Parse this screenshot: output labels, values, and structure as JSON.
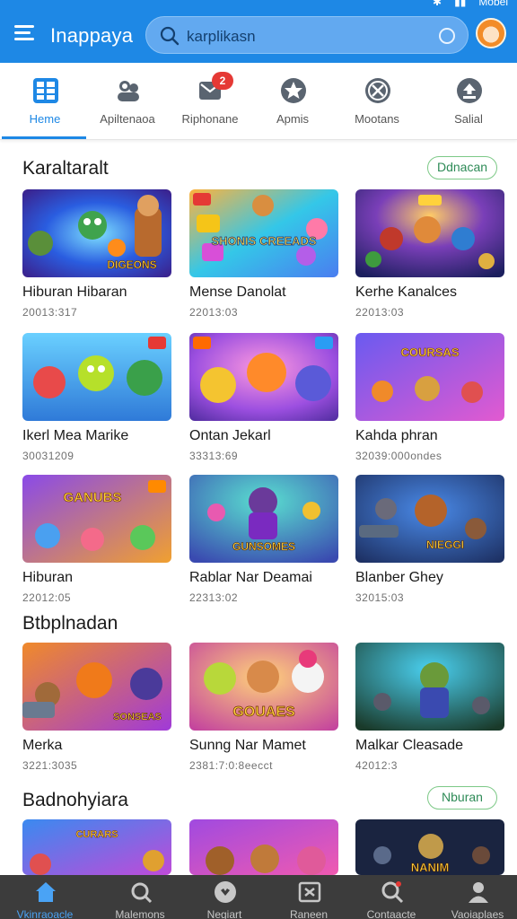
{
  "header": {
    "title": "Inappaya",
    "search_value": "karplikasn",
    "status_text": "Mobel",
    "colors": {
      "bar": "#1e88e5",
      "bottom_nav": "#3c3c3c",
      "accent": "#1e88e5",
      "more_border": "#7dc987"
    }
  },
  "tabs": [
    {
      "label": "Heme",
      "icon": "grid-icon",
      "active": true
    },
    {
      "label": "Apiltenaoa",
      "icon": "people-icon"
    },
    {
      "label": "Riphonane",
      "icon": "mail-icon",
      "badge": "2"
    },
    {
      "label": "Apmis",
      "icon": "star-icon"
    },
    {
      "label": "Mootans",
      "icon": "compass-icon"
    },
    {
      "label": "Salial",
      "icon": "download-icon"
    }
  ],
  "sections": [
    {
      "title": "Karaltaralt",
      "more": "Ddnacan",
      "cards": [
        {
          "title": "Hiburan Hibaran",
          "sub": "20013:317",
          "thumb_text": "DIGEONS"
        },
        {
          "title": "Mense Danolat",
          "sub": "22013:03",
          "thumb_text": "SHONIS CREEADS"
        },
        {
          "title": "Kerhe Kanalces",
          "sub": "22013:03",
          "thumb_text": ""
        },
        {
          "title": "Ikerl Mea Marike",
          "sub": "30031209",
          "thumb_text": ""
        },
        {
          "title": "Ontan Jekarl",
          "sub": "33313:69",
          "thumb_text": ""
        },
        {
          "title": "Kahda phran",
          "sub": "32039:000ondes",
          "thumb_text": "COURSAS"
        },
        {
          "title": "Hiburan",
          "sub": "22012:05",
          "thumb_text": "GANUBS"
        },
        {
          "title": "Rablar Nar Deamai",
          "sub": "22313:02",
          "thumb_text": "GUNSOMES"
        },
        {
          "title": "Blanber Ghey",
          "sub": "32015:03",
          "thumb_text": "NIEGGI"
        }
      ]
    },
    {
      "title": "Btbplnadan",
      "cards": [
        {
          "title": "Merka",
          "sub": "3221:3035",
          "thumb_text": "SONSEAS"
        },
        {
          "title": "Sunng Nar Mamet",
          "sub": "2381:7:0:8eecct",
          "thumb_text": "GOUAES"
        },
        {
          "title": "Malkar Cleasade",
          "sub": "42012:3",
          "thumb_text": ""
        }
      ]
    },
    {
      "title": "Badnohyiara",
      "more": "Nburan",
      "cards": [
        {
          "title": "",
          "sub": "",
          "thumb_text": "CURARS"
        },
        {
          "title": "",
          "sub": "",
          "thumb_text": ""
        },
        {
          "title": "",
          "sub": "",
          "thumb_text": "NANIM"
        }
      ]
    }
  ],
  "bottom_nav": [
    {
      "label": "Vkinraoacle",
      "icon": "home-icon",
      "active": true
    },
    {
      "label": "Malemons",
      "icon": "search-icon"
    },
    {
      "label": "Negiart",
      "icon": "heart-icon"
    },
    {
      "label": "Raneen",
      "icon": "box-icon"
    },
    {
      "label": "Contaacte",
      "icon": "magnifier-icon"
    },
    {
      "label": "Vaoiaplaes",
      "icon": "person-icon"
    }
  ]
}
